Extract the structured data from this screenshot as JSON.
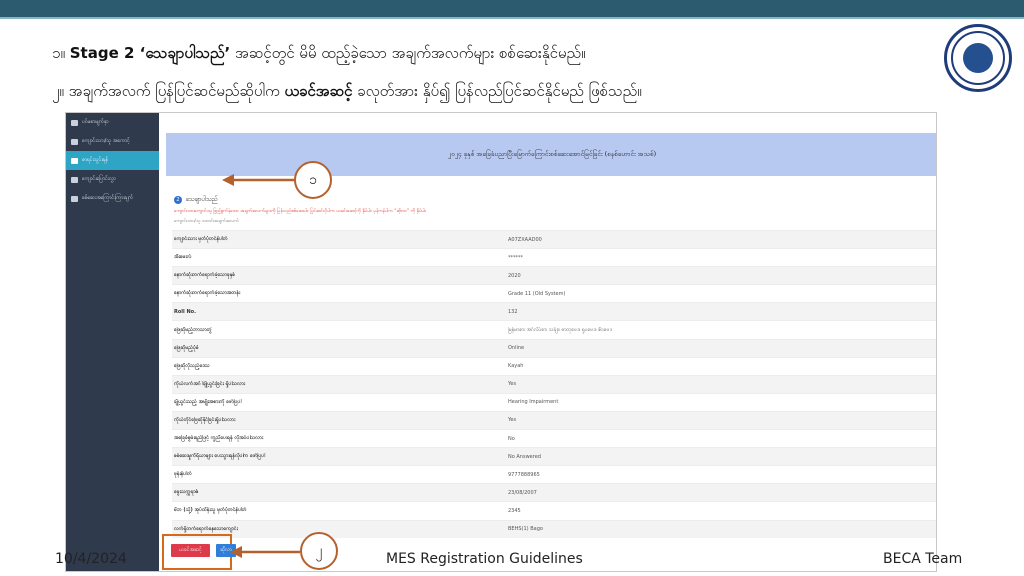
{
  "instructions": {
    "line1_prefix": "၁။ ",
    "line1_stage": "Stage 2 ",
    "line1_bold": "‘သေချာပါသည်’",
    "line1_rest": " အဆင့်တွင် မိမိ ထည့်ခဲ့သော အချက်အလက်များ စစ်ဆေးနိုင်မည်။",
    "line2_prefix": "၂။ အချက်အလက် ပြန်ပြင်ဆင်မည်ဆိုပါက ",
    "line2_bold": "ယခင်အဆင့်",
    "line2_rest": " ခလုတ်အား နှိပ်၍ ပြန်လည်ပြင်ဆင်နိုင်မည် ဖြစ်သည်။"
  },
  "sidebar": {
    "items": [
      {
        "label": "ပင်မစာမျက်နှာ",
        "active": false
      },
      {
        "label": "ကျောင်းသား/သူ အကောင့်",
        "active": false
      },
      {
        "label": "စာရင်းသွင်းရန်",
        "active": true
      },
      {
        "label": "ကျောင်းပြောင်းလွှာ",
        "active": false
      },
      {
        "label": "စစ်ဆေးအကြောင်းကြားချက်",
        "active": false
      }
    ]
  },
  "panel": {
    "title": "၂၀၂၄ ခုနှစ် အခြေခံပညာပြီးမြောက်ကြောင်းစစ်ဆေးအောင်မြင်ခြင်း (စနစ်ဟောင်း အသစ်)"
  },
  "section": {
    "step_number": "2",
    "title": "သေချာပါသည်",
    "warning": "ကျောင်းသားကျောင်းသူ ဖြည့်စွက်ခဲ့သော အချက်အလက်များကို ပြန်လည်စစ်ဆေးပါ။ ပြင်ဆင်လိုပါက ယခင်အဆင့်ကို နှိပ်ပါ။ မှန်ကန်ပါက “ဆိုလာ” ကို နှိပ်ပါ။",
    "subnote": "ကျောင်းသား/သူ သတင်းအချက်အလက်"
  },
  "table": {
    "rows": [
      {
        "label": "ကျောင်းသား မှတ်ပုံတင်နံပါတ်",
        "value": "A07ZXAAD00"
      },
      {
        "label": "အီးမေးလ်",
        "value": "******"
      },
      {
        "label": "နောက်ဆုံးတက်ရောက်ခဲ့သောခုနှစ်",
        "value": "2020"
      },
      {
        "label": "နောက်ဆုံးတက်ရောက်ခဲ့သောအတန်း",
        "value": "Grade 11 (Old System)"
      },
      {
        "label": "Roll No.",
        "value": "132"
      },
      {
        "label": "ဖြေဆိုမည့်ဘာသာတွဲ",
        "value": "မြန်မာစာ၊ အင်္ဂလိပ်စာ၊ သင်္ချာ၊ ဓာတုဗေဒ၊ ရူပဗေဒ၊ ဇီဝဗေဒ"
      },
      {
        "label": "ဖြေဆိုမည့်ပုံစံ",
        "value": "Online"
      },
      {
        "label": "ဖြေဆိုလိုသည့်ဒေသ",
        "value": "Kayah"
      },
      {
        "label": "ကိုယ်လက်အင်္ဂါချို့ယွင်းခြင်း ရှိပါသလား",
        "value": "Yes"
      },
      {
        "label": "ချို့ယွင်းသည့် အမျိုးအစားကို ဖော်ပြပါ",
        "value": "Hearing Impairment"
      },
      {
        "label": "ကိုယ်တိုင်ဖြေဆိုနိုင်ခြင်းရှိပါသလား",
        "value": "Yes"
      },
      {
        "label": "အခြေခံစွမ်းရည်ဖြင့် ကူညီပေးရန် လိုအပ်ပါသလား",
        "value": "No"
      },
      {
        "label": "စစ်ဆေးမှုကိရိယာများ ပေးသွားရန်လိုပါက ဖော်ပြပါ",
        "value": "No Answered"
      },
      {
        "label": "ဖုန်းနံပါတ်",
        "value": "9777888965"
      },
      {
        "label": "မွေးသက္ကရာဇ်",
        "value": "23/08/2007"
      },
      {
        "label": "မိဘ (သို့) အုပ်ထိန်းသူ မှတ်ပုံတင်နံပါတ်",
        "value": "2345"
      },
      {
        "label": "လက်ရှိတက်ရောက်နေသောကျောင်း",
        "value": "BEHS(1) Bago"
      }
    ]
  },
  "buttons": {
    "previous_label": "ယခင်အဆင့်",
    "submit_label": "ဆိုလာ"
  },
  "callouts": {
    "one": "၁",
    "two": "၂"
  },
  "footer": {
    "date": "10/4/2024",
    "title": "MES Registration Guidelines",
    "team": "BECA Team"
  },
  "colors": {
    "top_bar": "#2c5a6f",
    "sidebar": "#2f3b4c",
    "sidebar_active": "#2fa5c6",
    "panel_header": "#b7c9f1",
    "previous_button": "#dd3a4b",
    "submit_button": "#2f7ed8",
    "callout_border": "#b5612d",
    "highlight_box": "#d5691e",
    "warning_text": "#e0352b"
  }
}
